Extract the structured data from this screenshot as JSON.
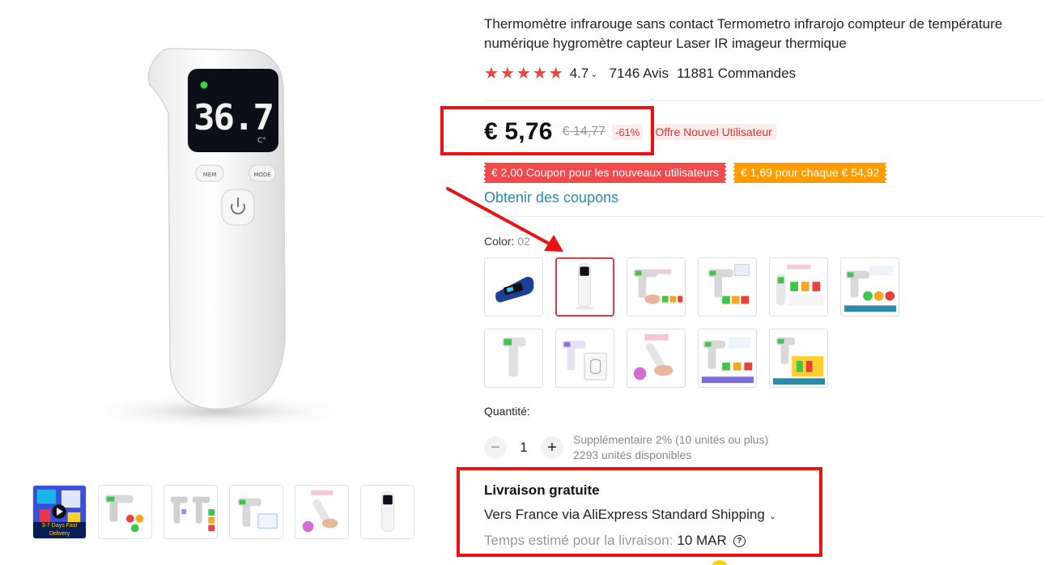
{
  "product": {
    "title": "Thermomètre infrarouge sans contact Termometro infrarojo compteur de température numérique hygromètre capteur Laser IR imageur thermique",
    "rating": "4.7",
    "reviews": "7146 Avis",
    "orders": "11881 Commandes",
    "display_reading": "36.7",
    "display_unit": "C°",
    "btn_mem": "MEM",
    "btn_mode": "MODE"
  },
  "pricing": {
    "price": "€ 5,76",
    "old_price": "€ 14,77",
    "discount": "-61%",
    "new_user_offer": "Offre Nouvel Utilisateur",
    "coupon_new_users": "€ 2,00 Coupon pour les nouveaux utilisateurs",
    "coupon_spend": "€ 1,69 pour chaque € 54,92",
    "get_coupons": "Obtenir des coupons",
    "coupon_colors": {
      "red": "#f04a4a",
      "orange": "#ff9c00"
    }
  },
  "variants": {
    "label": "Color:",
    "selected_value": "02",
    "selected_index": 1,
    "count": 11
  },
  "quantity": {
    "label": "Quantité:",
    "value": "1",
    "minus": "−",
    "plus": "+",
    "bulk_note": "Supplémentaire 2% (10 unités ou plus)",
    "stock_note": "2293 unités disponibles"
  },
  "shipping": {
    "title": "Livraison gratuite",
    "method": "Vers France via AliExpress Standard Shipping",
    "eta_label": "Temps estimé pour la livraison:",
    "eta_date": "10 MAR"
  },
  "thumbnails": {
    "badge_text": "3-7 Days Fast Delivery",
    "count": 6
  },
  "icons": {
    "star": "star-icon",
    "chevron": "chevron-down-icon",
    "help": "question-circle-icon",
    "power": "power-icon",
    "play": "play-icon"
  },
  "colors": {
    "accent_red": "#f0413c",
    "link": "#2b8aa8",
    "annotation": "#ee1111"
  }
}
